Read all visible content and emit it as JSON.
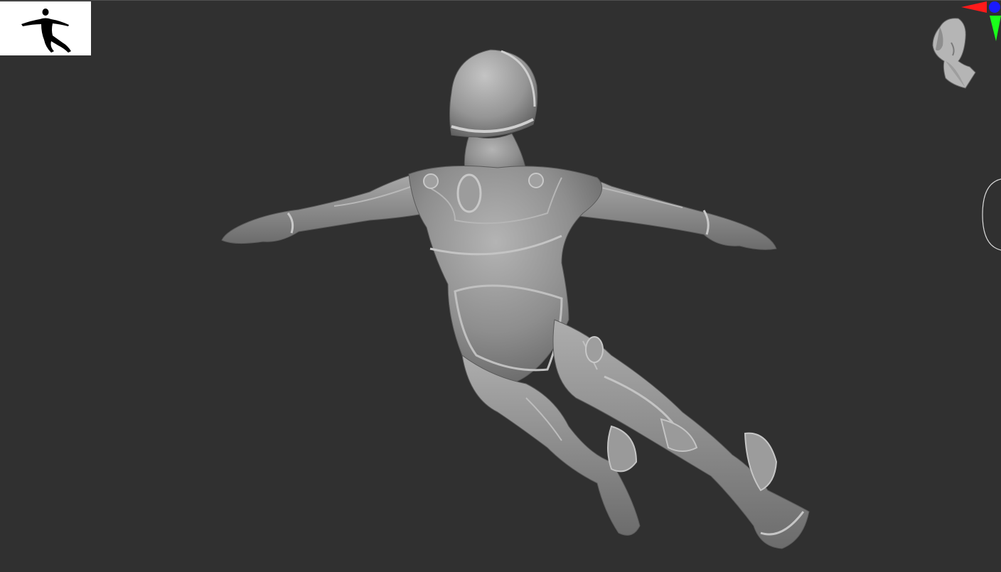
{
  "viewport": {
    "background": "#303030",
    "mesh_color": "#8f8f8f"
  },
  "thumbnail": {
    "icon": "figure-silhouette-icon",
    "background": "#ffffff"
  },
  "gizmo": {
    "icon": "xyz-axis-gizmo-icon",
    "x_color": "#ff1a1a",
    "y_color": "#1aff1a",
    "z_color": "#1a1aff"
  },
  "navigator": {
    "icon": "head-orientation-icon"
  },
  "rotate_ring": {
    "icon": "rotate-ring-icon"
  }
}
